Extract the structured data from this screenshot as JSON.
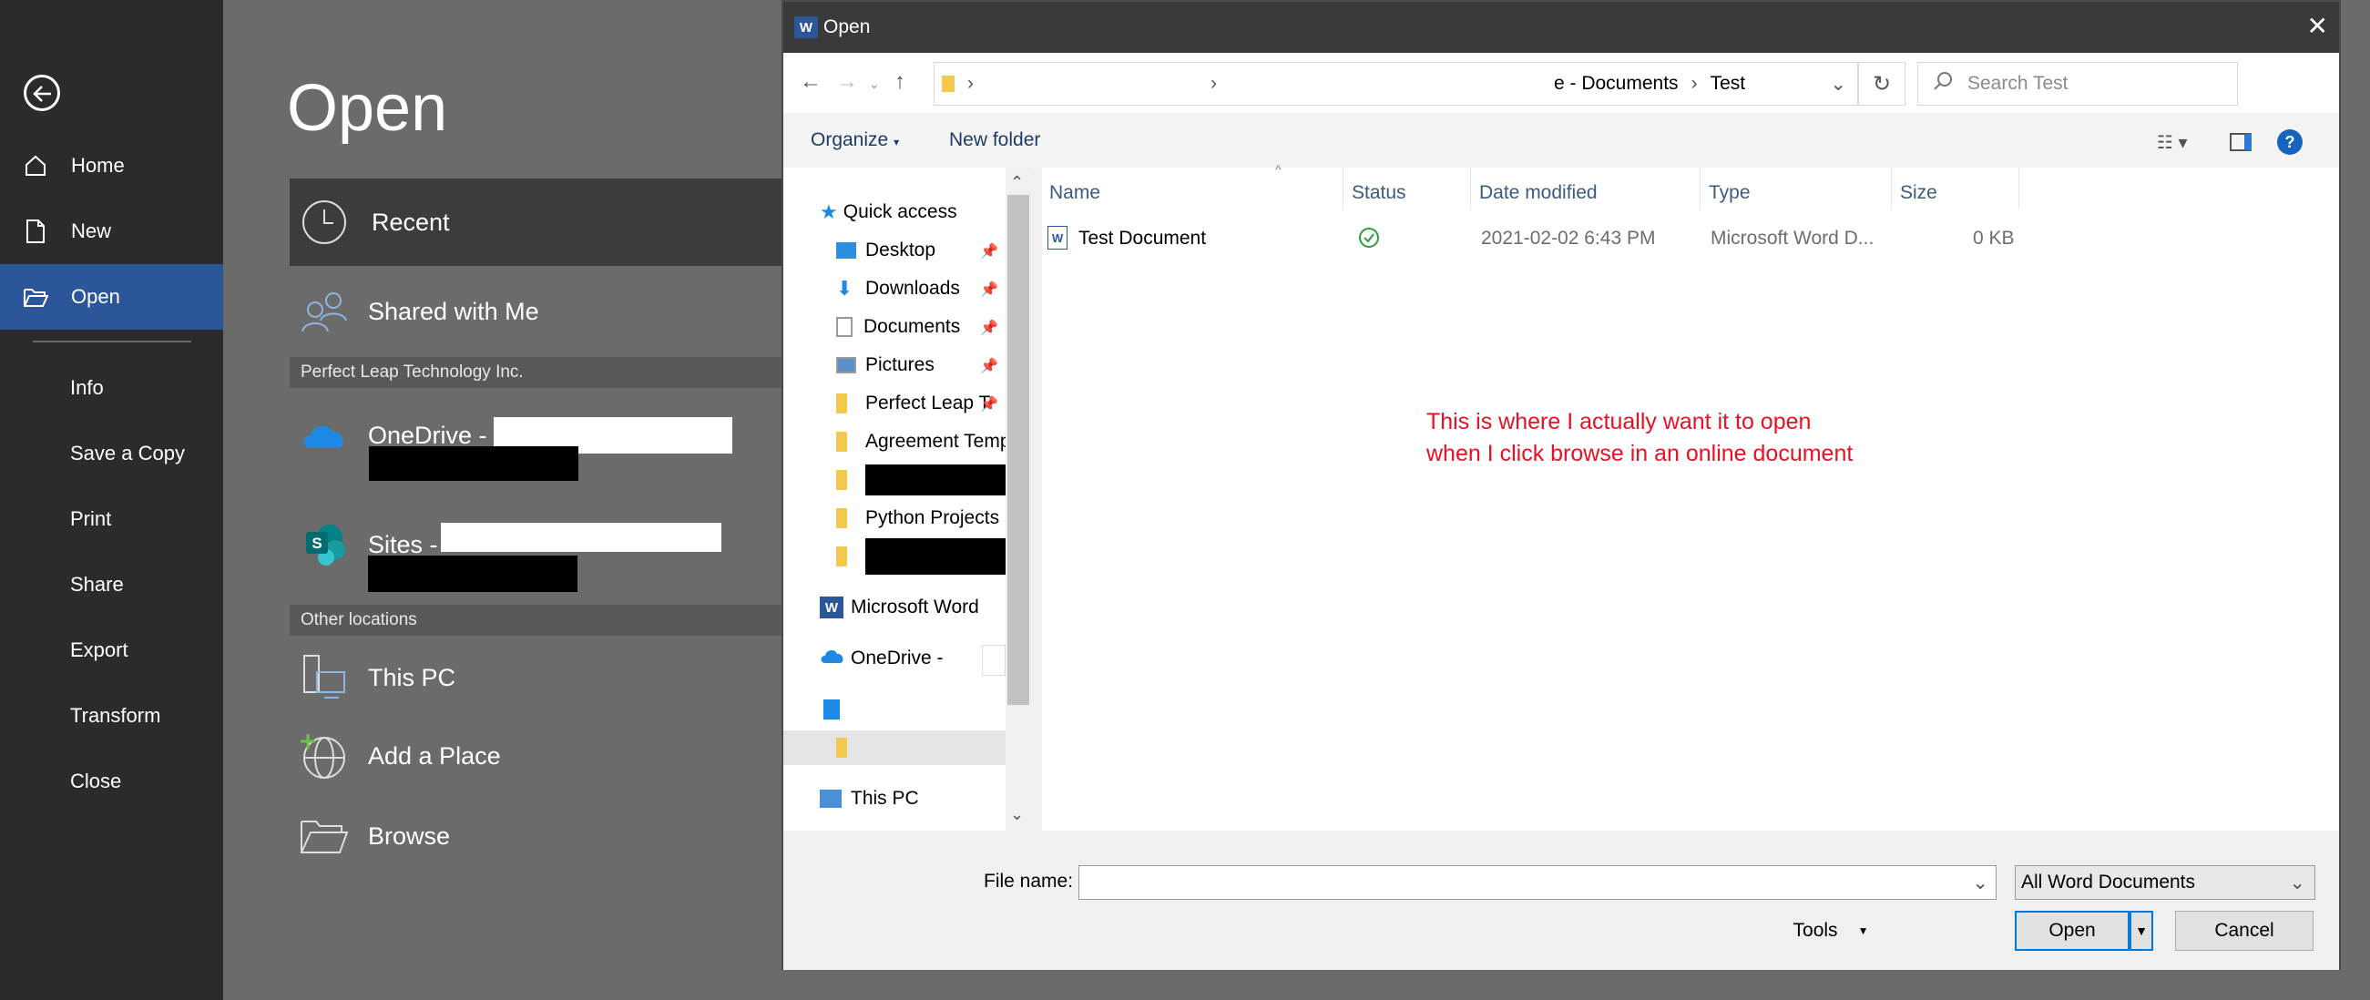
{
  "backstage": {
    "title": "Open",
    "rail": {
      "home": "Home",
      "new": "New",
      "open": "Open",
      "info": "Info",
      "save_copy": "Save a Copy",
      "print": "Print",
      "share": "Share",
      "export": "Export",
      "transform": "Transform",
      "close": "Close"
    },
    "locations": {
      "recent": "Recent",
      "shared": "Shared with Me",
      "org_header": "Perfect Leap Technology Inc.",
      "onedrive": "OneDrive -",
      "sites": "Sites -",
      "other_header": "Other locations",
      "this_pc": "This PC",
      "add_place": "Add a Place",
      "browse": "Browse"
    }
  },
  "dialog": {
    "title": "Open",
    "address": {
      "crumb1": "e - Documents",
      "crumb2": "Test"
    },
    "search_placeholder": "Search Test",
    "toolbar": {
      "organize": "Organize",
      "new_folder": "New folder"
    },
    "tree": {
      "quick_access": "Quick access",
      "desktop": "Desktop",
      "downloads": "Downloads",
      "documents": "Documents",
      "pictures": "Pictures",
      "perfect_leap": "Perfect Leap T",
      "agreement": "Agreement Temp",
      "python": "Python Projects",
      "ms_word": "Microsoft Word",
      "onedrive": "OneDrive -",
      "this_pc": "This PC"
    },
    "columns": {
      "name": "Name",
      "status": "Status",
      "date": "Date modified",
      "type": "Type",
      "size": "Size"
    },
    "files": [
      {
        "name": "Test Document",
        "date": "2021-02-02 6:43 PM",
        "type": "Microsoft Word D...",
        "size": "0 KB"
      }
    ],
    "annotation": {
      "line1": "This is where I actually want it to open",
      "line2": "when I click browse in an online document"
    },
    "bottom": {
      "file_name_label": "File name:",
      "file_type": "All Word Documents",
      "tools": "Tools",
      "open": "Open",
      "cancel": "Cancel"
    }
  }
}
